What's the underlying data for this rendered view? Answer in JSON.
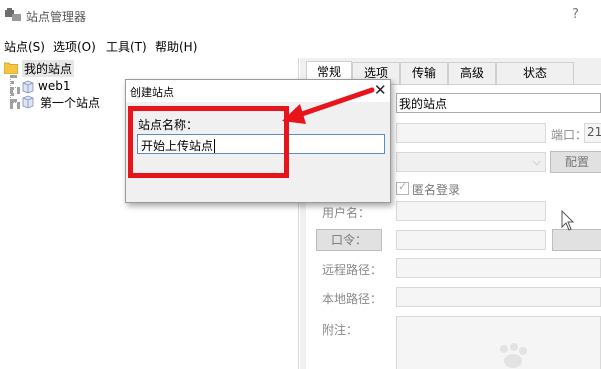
{
  "window": {
    "title": "站点管理器",
    "help": "?"
  },
  "menu": [
    "站点(S)",
    "选项(O)",
    "工具(T)",
    "帮助(H)"
  ],
  "tree": {
    "root": "我的站点",
    "items": [
      "web1",
      "第一个站点"
    ]
  },
  "tabs": [
    "常规",
    "选项",
    "传输",
    "高级",
    "状态"
  ],
  "general": {
    "site_name_value": "我的站点",
    "port_label": "端口：",
    "port_value": "21",
    "config_button": "配置",
    "anonymous_label": "匿名登录",
    "username_label": "用户名：",
    "password_button": "口令：",
    "remote_path_label": "远程路径：",
    "local_path_label": "本地路径：",
    "note_label": "附注："
  },
  "dialog": {
    "title": "创建站点",
    "close": "✕",
    "label": "站点名称：",
    "input_value": "开始上传站点"
  },
  "colors": {
    "annotation": "#e8141b",
    "input_focus": "#5a8cc8",
    "dialog_bg": "#f0f0f0"
  }
}
